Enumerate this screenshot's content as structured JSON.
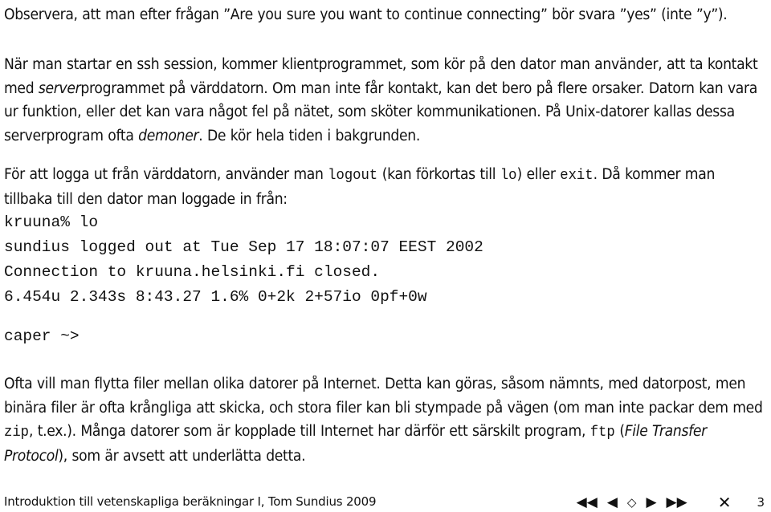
{
  "paragraphs": {
    "p0": {
      "text": "Observera, att man efter frågan ”Are you sure you want to continue connecting” bör svara ”yes” (inte ”y”)."
    },
    "p1": {
      "s1": "När man startar en ssh session, kommer klientprogrammet, som kör på den dator man använder, att ta kontakt med ",
      "em1": "server",
      "s2": "programmet på värddatorn. Om man inte får kontakt, kan det bero på flere orsaker. Datorn kan vara ur funktion, eller det kan vara något fel på nätet, som sköter kommunikationen. På Unix-datorer kallas dessa serverprogram ofta ",
      "em2": "demoner",
      "s3": ". De kör hela tiden i bakgrunden."
    },
    "p2": {
      "s1": "För att logga ut från värddatorn, använder man ",
      "code1": "logout",
      "s2": " (kan förkortas till ",
      "code2": "lo",
      "s3": ") eller ",
      "code3": "exit",
      "s4": ". Då kommer man tillbaka till den dator man loggade in från:"
    },
    "p3": {
      "s1": "Ofta vill man flytta filer mellan olika datorer på Internet. Detta kan göras, såsom nämnts, med datorpost, men binära filer är ofta krångliga att skicka, och stora filer kan bli stympade på vägen (om man inte packar dem med ",
      "code1": "zip",
      "s2": ", t.ex.). Många datorer som är kopplade till Internet har därför ett särskilt program, ",
      "code2": "ftp",
      "s3": " (",
      "em1": "File Transfer Protocol",
      "s4": "), som är avsett att underlätta detta."
    }
  },
  "terminal": {
    "lines": [
      "kruuna% lo",
      "sundius logged out at Tue Sep 17 18:07:07 EEST 2002",
      "Connection to kruuna.helsinki.fi closed.",
      "6.454u 2.343s 8:43.27 1.6% 0+2k 2+57io 0pf+0w"
    ],
    "prompt": "caper ~>"
  },
  "footer": {
    "title": "Introduktion till vetenskapliga beräkningar I, Tom Sundius 2009",
    "nav": {
      "first_icon": "◀◀",
      "prev_icon": "◀",
      "home_icon": "◇",
      "next_icon": "▶",
      "last_icon": "▶▶",
      "close_icon": "✕"
    },
    "page_number": "3"
  }
}
